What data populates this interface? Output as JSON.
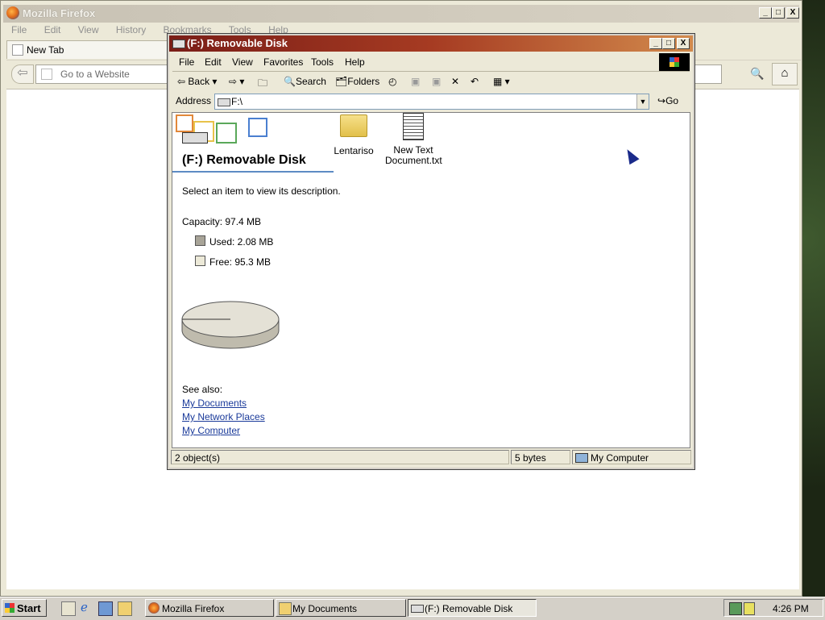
{
  "firefox": {
    "title": "Mozilla Firefox",
    "menu": [
      "File",
      "Edit",
      "View",
      "History",
      "Bookmarks",
      "Tools",
      "Help"
    ],
    "tab_label": "New Tab",
    "url_placeholder": "Go to a Website",
    "controls": {
      "minimize": "_",
      "maximize": "□",
      "close": "X"
    }
  },
  "explorer": {
    "title": "(F:) Removable Disk",
    "menu": [
      "File",
      "Edit",
      "View",
      "Favorites",
      "Tools",
      "Help"
    ],
    "toolbar": {
      "back": "Back",
      "search": "Search",
      "folders": "Folders"
    },
    "address_label": "Address",
    "address_value": "F:\\",
    "go_label": "Go",
    "panel": {
      "title": "(F:) Removable Disk",
      "description": "Select an item to view its description.",
      "capacity": "Capacity: 97.4 MB",
      "used": "Used: 2.08 MB",
      "free": "Free: 95.3 MB",
      "see_also": "See also:",
      "links": [
        "My Documents",
        "My Network Places",
        "My Computer"
      ]
    },
    "files": [
      {
        "name": "Lentariso",
        "icon": "folder-icon"
      },
      {
        "name": "New Text Document.txt",
        "icon": "text-file-icon"
      }
    ],
    "status": {
      "objects": "2 object(s)",
      "size": "5 bytes",
      "zone": "My Computer"
    }
  },
  "taskbar": {
    "start": "Start",
    "tasks": [
      "Mozilla Firefox",
      "My Documents",
      "(F:) Removable Disk"
    ],
    "clock": "4:26 PM"
  },
  "colors": {
    "explorer_title_start": "#7a1d17",
    "explorer_title_end": "#d28a4c",
    "link": "#1a3a9a"
  }
}
